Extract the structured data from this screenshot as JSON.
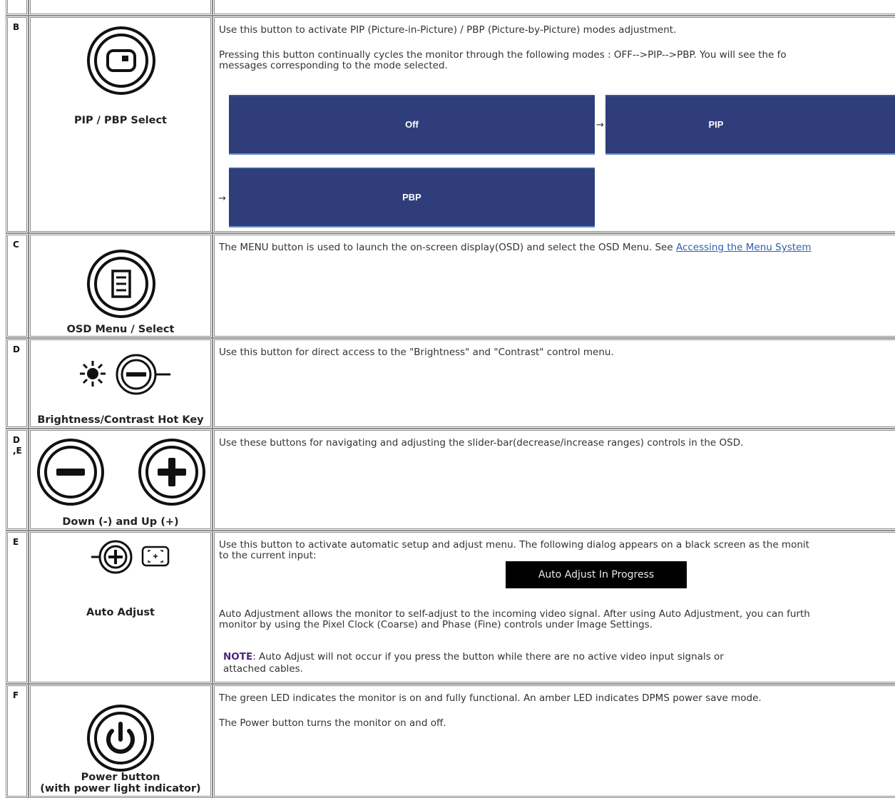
{
  "rows": {
    "top": {},
    "b": {
      "key": "B",
      "label": "PIP / PBP Select",
      "desc1": "Use this button to activate PIP (Picture-in-Picture) / PBP (Picture-by-Picture) modes adjustment.",
      "desc2a": "Pressing this button continually cycles the monitor through the following modes : OFF-->PIP-->PBP. You will see the fo",
      "desc2b": "messages corresponding to the mode selected.",
      "mode_off": "Off",
      "mode_pip": "PIP",
      "mode_pbp": "PBP",
      "arrow": "→"
    },
    "c": {
      "key": "C",
      "label": "OSD Menu / Select",
      "desc_prefix": "The MENU button is used to launch the on-screen display(OSD) and select the OSD Menu. See ",
      "link": "Accessing the Menu System"
    },
    "d": {
      "key": "D",
      "label": "Brightness/Contrast Hot Key",
      "desc": "Use this button for direct access to the \"Brightness\" and \"Contrast\" control menu."
    },
    "de": {
      "key1": "D",
      "key2": ",E",
      "label": "Down (-) and Up (+)",
      "desc": "Use these buttons for navigating and adjusting the slider-bar(decrease/increase ranges) controls in the OSD."
    },
    "e": {
      "key": "E",
      "label": "Auto Adjust",
      "desc1a": "Use this button to activate automatic setup and adjust menu. The following dialog appears on a black screen as the monit",
      "desc1b": "to the current input:",
      "dialog": "Auto Adjust In Progress",
      "desc2a": "Auto Adjustment allows the monitor to self-adjust to the incoming video signal. After using Auto Adjustment, you can furth",
      "desc2b": "monitor by using the Pixel Clock (Coarse) and Phase (Fine) controls under Image Settings.",
      "note_label": "NOTE",
      "note_a": ": Auto Adjust will not occur if you press the button while there are no active video input signals or",
      "note_b": "attached cables."
    },
    "f": {
      "key": "F",
      "label1": "Power button",
      "label2": "(with power light indicator)",
      "desc1": "The green LED indicates the monitor is on and fully functional. An amber LED indicates DPMS power save mode.",
      "desc2": "The Power button turns the monitor on and off."
    }
  }
}
